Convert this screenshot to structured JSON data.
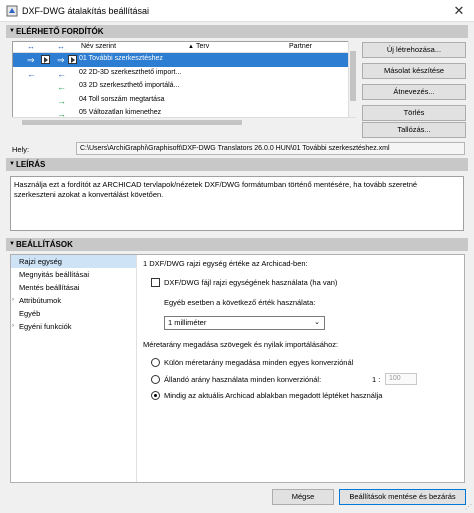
{
  "window": {
    "title": "DXF-DWG átalakítás beállításai",
    "close_glyph": "✕"
  },
  "sections": {
    "translators": "ELÉRHETŐ FORDÍTÓK",
    "description": "LEÍRÁS",
    "settings": "BEÁLLÍTÁSOK"
  },
  "table": {
    "headers": {
      "name": "Név szerint",
      "plan": "Terv",
      "partner": "Partner"
    },
    "rows": [
      {
        "name": "01 További szerkesztéshez",
        "selected": true
      },
      {
        "name": "02 2D-3D szerkeszthető import...",
        "selected": false
      },
      {
        "name": "03 2D szerkeszthető importálá...",
        "selected": false
      },
      {
        "name": "04 Toll sorszám megtartása",
        "selected": false
      },
      {
        "name": "05 Változatlan kimenethez",
        "selected": false
      }
    ]
  },
  "buttons": {
    "new": "Új létrehozása...",
    "copy": "Másolat készítése",
    "rename": "Átnevezés...",
    "delete": "Törlés",
    "browse": "Tallózás...",
    "cancel": "Mégse",
    "save_close": "Beállítások mentése és bezárás"
  },
  "path": {
    "label": "Hely:",
    "value": "C:\\Users\\ArchiGraphi\\Graphisoft\\DXF-DWG Translators 26.0.0 HUN\\01 További szerkesztéshez.xml"
  },
  "description": "Használja ezt a fordítót az ARCHICAD tervlapok/nézetek DXF/DWG formátumban történő mentésére, ha tovább szeretné szerkeszteni azokat a konvertálást követően.",
  "nav": [
    {
      "label": "Rajzi egység",
      "selected": true,
      "expandable": false
    },
    {
      "label": "Megnyitás beállításai",
      "selected": false,
      "expandable": false
    },
    {
      "label": "Mentés beállításai",
      "selected": false,
      "expandable": false
    },
    {
      "label": "Attribútumok",
      "selected": false,
      "expandable": true
    },
    {
      "label": "Egyéb",
      "selected": false,
      "expandable": false
    },
    {
      "label": "Egyéni funkciók",
      "selected": false,
      "expandable": true
    }
  ],
  "pane": {
    "unit_heading": "1 DXF/DWG rajzi egység értéke az Archicad-ben:",
    "use_file_unit": "DXF/DWG fájl rajzi egységének használata (ha van)",
    "otherwise_label": "Egyéb esetben a következő érték használata:",
    "unit_value": "1 milliméter",
    "scale_heading": "Méretarány megadása szövegek és nyilak importálásához:",
    "option_each": "Külön méretarány megadása minden egyes konverziónál",
    "option_fixed": "Állandó arány használata minden konverziónál:",
    "ratio_prefix": "1 :",
    "ratio_value": "100",
    "option_window": "Mindig az aktuális Archicad ablakban megadott léptéket használja"
  }
}
